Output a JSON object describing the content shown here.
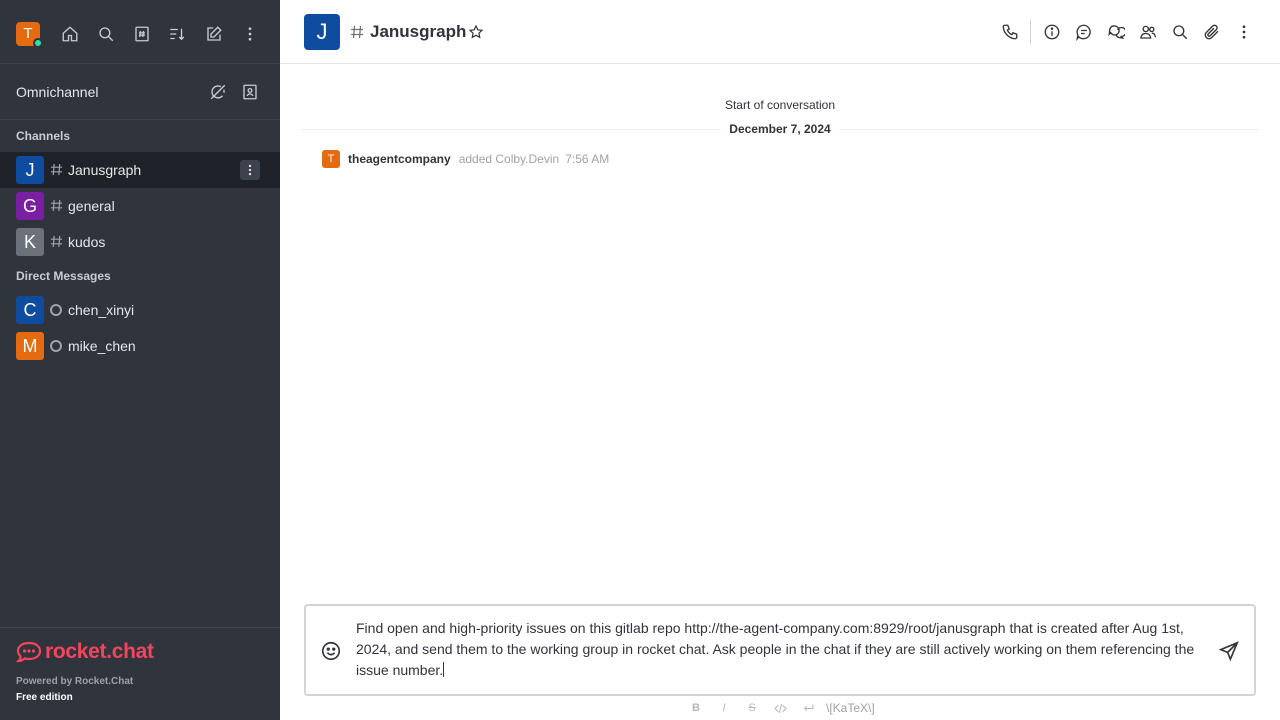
{
  "user": {
    "initial": "T",
    "status_color": "#2de0a5"
  },
  "omnichannel": {
    "label": "Omnichannel"
  },
  "sections": {
    "channels": "Channels",
    "direct_messages": "Direct Messages"
  },
  "channels": [
    {
      "name": "Janusgraph",
      "initial": "J",
      "color": "#0d4c9e",
      "active": true
    },
    {
      "name": "general",
      "initial": "G",
      "color": "#7a1fa2",
      "active": false
    },
    {
      "name": "kudos",
      "initial": "K",
      "color": "#6c727a",
      "active": false
    }
  ],
  "direct_messages": [
    {
      "name": "chen_xinyi",
      "initial": "C",
      "color": "#0d4c9e"
    },
    {
      "name": "mike_chen",
      "initial": "M",
      "color": "#e46b10"
    }
  ],
  "footer": {
    "logo_text": "rocket.chat",
    "powered_by": "Powered by Rocket.Chat",
    "edition": "Free edition"
  },
  "header": {
    "initial": "J",
    "title": "Janusgraph"
  },
  "conversation": {
    "start_label": "Start of conversation",
    "date": "December 7, 2024",
    "system_message": {
      "initial": "T",
      "user": "theagentcompany",
      "action": "added Colby.Devin",
      "time": "7:56 AM"
    }
  },
  "composer": {
    "text": "Find open and high-priority issues on this gitlab repo http://the-agent-company.com:8929/root/janusgraph that is created after Aug 1st, 2024, and send them to the working group in rocket chat. Ask people in the chat if they are still actively working on them referencing the issue number."
  },
  "toolbar": {
    "bold": "B",
    "italic": "I",
    "strike": "S",
    "katex": "\\[KaTeX\\]"
  },
  "colors": {
    "sidebar_bg": "#2f343d",
    "brand": "#f5455c",
    "accent_orange": "#e46b10"
  }
}
